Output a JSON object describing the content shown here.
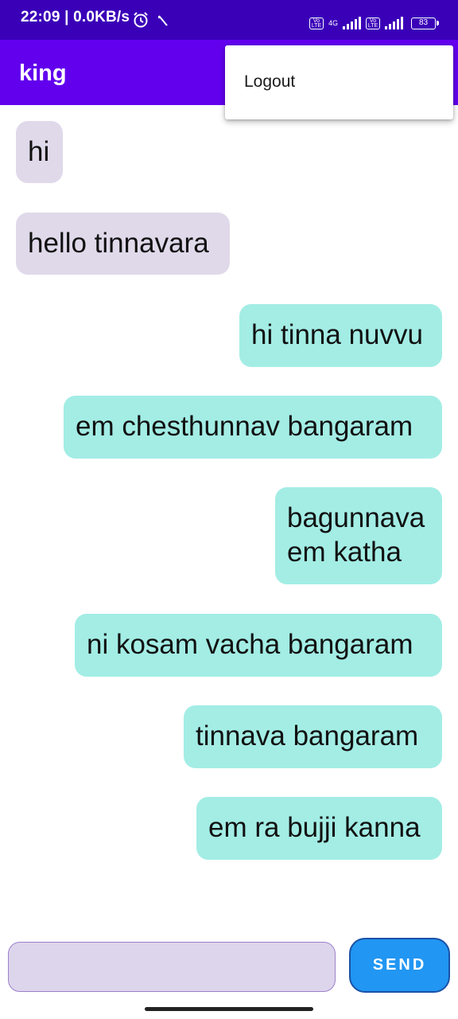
{
  "status_bar": {
    "time": "22:09 | 0.0KB/s",
    "network": "4G",
    "battery": "83"
  },
  "app_bar": {
    "title": "king"
  },
  "overflow_menu": {
    "items": [
      {
        "label": "Logout"
      }
    ]
  },
  "messages": [
    {
      "text": "hi",
      "direction": "incoming"
    },
    {
      "text": "hello tinnavara",
      "direction": "incoming"
    },
    {
      "text": "hi tinna nuvvu",
      "direction": "outgoing"
    },
    {
      "text": "em chesthunnav bangaram",
      "direction": "outgoing"
    },
    {
      "text": "bagunnava\nem katha",
      "direction": "outgoing"
    },
    {
      "text": "ni kosam vacha bangaram",
      "direction": "outgoing"
    },
    {
      "text": "tinnava bangaram",
      "direction": "outgoing"
    },
    {
      "text": "em ra bujji kanna",
      "direction": "outgoing"
    }
  ],
  "composer": {
    "input_value": "",
    "send_label": "SEND"
  },
  "colors": {
    "status_bar": "#3a00b8",
    "app_bar": "#6200ee",
    "incoming_bubble": "#e0d9ea",
    "outgoing_bubble": "#a3ede5",
    "send_button": "#2196f3"
  }
}
